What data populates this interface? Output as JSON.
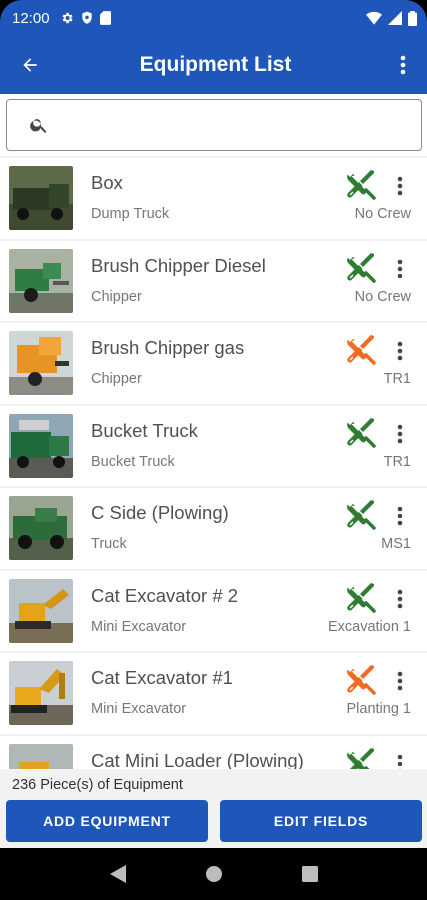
{
  "status": {
    "time": "12:00"
  },
  "header": {
    "title": "Equipment List"
  },
  "search": {
    "placeholder": ""
  },
  "equipment": [
    {
      "name": "Box",
      "type": "Dump Truck",
      "crew": "No Crew",
      "status": "green"
    },
    {
      "name": "Brush Chipper Diesel",
      "type": "Chipper",
      "crew": "No Crew",
      "status": "green"
    },
    {
      "name": "Brush Chipper gas",
      "type": "Chipper",
      "crew": "TR1",
      "status": "orange"
    },
    {
      "name": "Bucket Truck",
      "type": "Bucket Truck",
      "crew": "TR1",
      "status": "green"
    },
    {
      "name": "C Side (Plowing)",
      "type": "Truck",
      "crew": "MS1",
      "status": "green"
    },
    {
      "name": "Cat Excavator # 2",
      "type": "Mini Excavator",
      "crew": "Excavation 1",
      "status": "green"
    },
    {
      "name": "Cat Excavator #1",
      "type": "Mini Excavator",
      "crew": "Planting 1",
      "status": "orange"
    },
    {
      "name": "Cat Mini Loader (Plowing)",
      "type": "",
      "crew": "",
      "status": "green"
    }
  ],
  "footer": {
    "count_text": "236 Piece(s) of Equipment",
    "add_label": "ADD EQUIPMENT",
    "edit_label": "EDIT FIELDS"
  },
  "colors": {
    "primary": "#1e56b9",
    "tool_green": "#2e7d32",
    "tool_orange": "#f26b21"
  },
  "icons": {
    "tool": "wrench-screwdriver-icon",
    "more": "more-vert-icon",
    "back": "arrow-back-icon",
    "search": "search-icon"
  }
}
